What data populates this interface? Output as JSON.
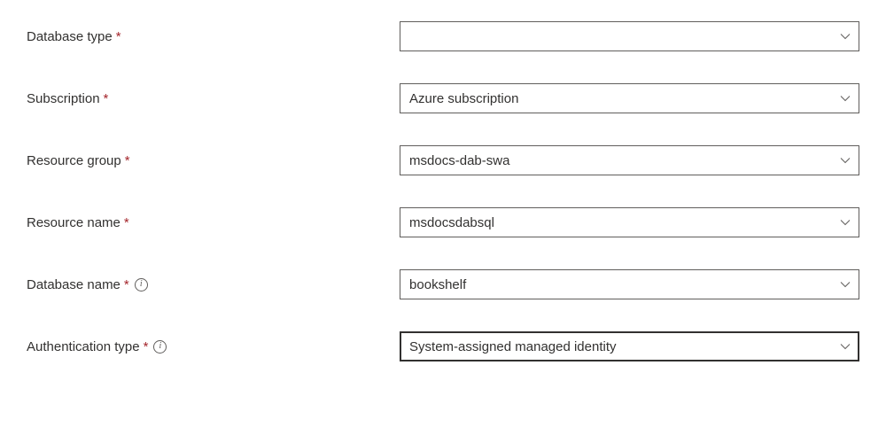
{
  "form": {
    "required_marker": "*",
    "fields": [
      {
        "key": "database_type",
        "label": "Database type",
        "required": true,
        "info": false,
        "value": "",
        "focused": false
      },
      {
        "key": "subscription",
        "label": "Subscription",
        "required": true,
        "info": false,
        "value": "Azure subscription",
        "focused": false
      },
      {
        "key": "resource_group",
        "label": "Resource group",
        "required": true,
        "info": false,
        "value": "msdocs-dab-swa",
        "focused": false
      },
      {
        "key": "resource_name",
        "label": "Resource name",
        "required": true,
        "info": false,
        "value": "msdocsdabsql",
        "focused": false
      },
      {
        "key": "database_name",
        "label": "Database name",
        "required": true,
        "info": true,
        "value": "bookshelf",
        "focused": false
      },
      {
        "key": "authentication_type",
        "label": "Authentication type",
        "required": true,
        "info": true,
        "value": "System-assigned managed identity",
        "focused": true
      }
    ]
  }
}
